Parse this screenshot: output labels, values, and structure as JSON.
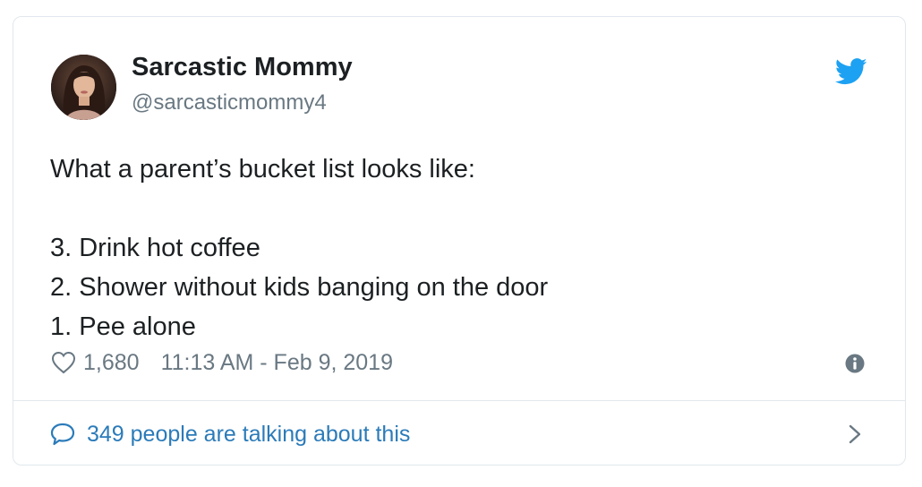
{
  "author": {
    "display_name": "Sarcastic Mommy",
    "handle": "@sarcasticmommy4"
  },
  "tweet": {
    "text": "What a parent’s bucket list looks like:\n\n3. Drink hot coffee\n2. Shower without kids banging on the door\n1. Pee alone"
  },
  "meta": {
    "like_count": "1,680",
    "timestamp": "11:13 AM - Feb 9, 2019"
  },
  "conversation": {
    "label": "349 people are talking about this"
  },
  "icons": {
    "brand": "twitter-bird-icon",
    "like": "heart-icon",
    "info": "info-icon",
    "conversation": "speech-bubble-icon",
    "navigate": "chevron-right-icon"
  },
  "colors": {
    "twitter_blue": "#1da1f2",
    "link_blue": "#2b7bb9",
    "muted_text": "#697882",
    "border": "#e1e8ed"
  }
}
